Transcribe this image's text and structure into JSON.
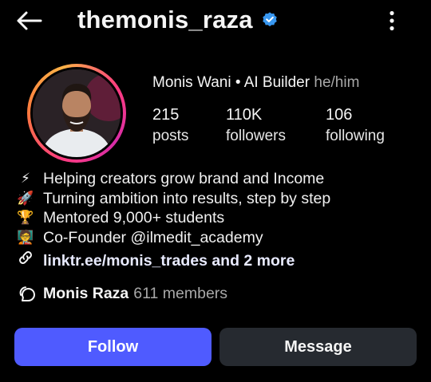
{
  "header": {
    "username": "themonis_raza",
    "verified": true,
    "back_icon": "arrow-left-icon",
    "more_icon": "more-vertical-icon"
  },
  "profile": {
    "display_name": "Monis Wani • AI Builder",
    "pronouns": "he/him",
    "stats": [
      {
        "value": "215",
        "label": "posts"
      },
      {
        "value": "110K",
        "label": "followers"
      },
      {
        "value": "106",
        "label": "following"
      }
    ]
  },
  "bio": {
    "lines": [
      {
        "icon": "lightning-icon",
        "glyph": "⚡",
        "text": "Helping creators grow brand and Income"
      },
      {
        "icon": "rocket-icon",
        "glyph": "🚀",
        "text": "Turning ambition into results, step by step"
      },
      {
        "icon": "trophy-icon",
        "glyph": "🏆",
        "text": "Mentored 9,000+ students"
      },
      {
        "icon": "teacher-icon",
        "glyph": "🧑‍🏫",
        "text": "Co-Founder @ilmedit_academy"
      }
    ],
    "link_text": "linktr.ee/monis_trades and 2 more"
  },
  "community": {
    "name": "Monis Raza",
    "members": "611 members"
  },
  "buttons": {
    "follow": "Follow",
    "message": "Message"
  },
  "colors": {
    "background": "#000000",
    "follow_button": "#4f5bff",
    "message_button": "#262a30",
    "verified_badge": "#3897f0",
    "secondary_text": "#a8a8a8"
  }
}
